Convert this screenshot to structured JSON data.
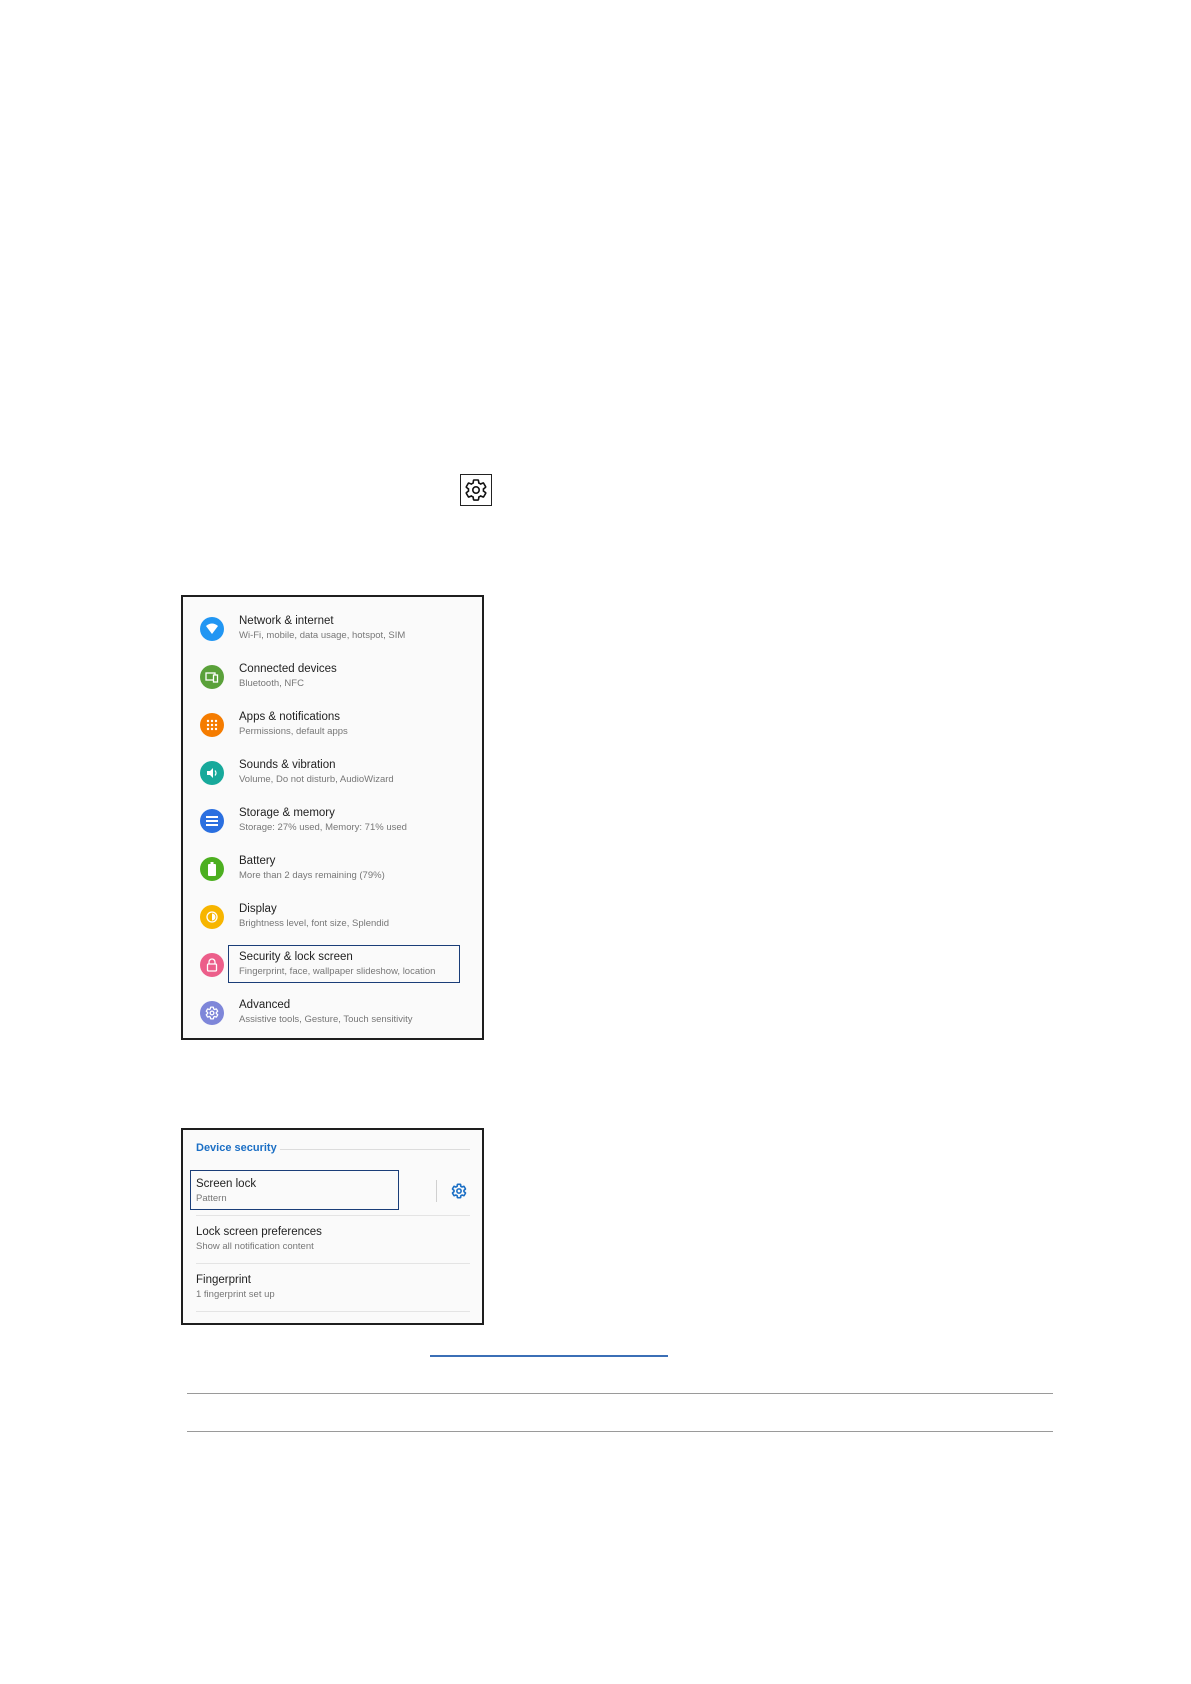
{
  "toolbar_icon": {
    "icon": "gear-icon"
  },
  "settings_menu": {
    "items": [
      {
        "title": "Network & internet",
        "subtitle": "Wi-Fi, mobile, data usage, hotspot, SIM",
        "icon": "wifi-icon",
        "color": "#2196f3"
      },
      {
        "title": "Connected devices",
        "subtitle": "Bluetooth, NFC",
        "icon": "devices-icon",
        "color": "#5aa13a"
      },
      {
        "title": "Apps & notifications",
        "subtitle": "Permissions, default apps",
        "icon": "apps-icon",
        "color": "#f57c00"
      },
      {
        "title": "Sounds & vibration",
        "subtitle": "Volume, Do not disturb, AudioWizard",
        "icon": "volume-icon",
        "color": "#17a99b"
      },
      {
        "title": "Storage & memory",
        "subtitle": "Storage: 27% used, Memory: 71% used",
        "icon": "storage-icon",
        "color": "#2a6fe0"
      },
      {
        "title": "Battery",
        "subtitle": "More than 2 days remaining (79%)",
        "icon": "battery-icon",
        "color": "#4caf20"
      },
      {
        "title": "Display",
        "subtitle": "Brightness level, font size, Splendid",
        "icon": "brightness-icon",
        "color": "#f7b500"
      },
      {
        "title": "Security & lock screen",
        "subtitle": "Fingerprint, face, wallpaper slideshow, location",
        "icon": "lock-icon",
        "color": "#ec5e8a"
      },
      {
        "title": "Advanced",
        "subtitle": "Assistive tools, Gesture, Touch sensitivity",
        "icon": "gear-icon",
        "color": "#7e86d9"
      }
    ]
  },
  "security_menu": {
    "header": "Device security",
    "header_color": "#1b6fc5",
    "items": [
      {
        "title": "Screen lock",
        "subtitle": "Pattern"
      },
      {
        "title": "Lock screen preferences",
        "subtitle": "Show all notification content"
      },
      {
        "title": "Fingerprint",
        "subtitle": "1 fingerprint set up"
      }
    ]
  }
}
